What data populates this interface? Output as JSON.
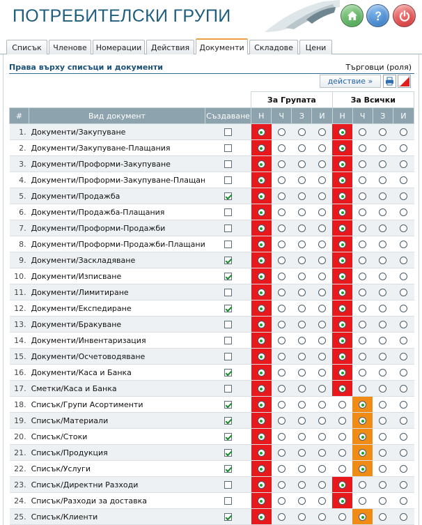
{
  "header": {
    "title": "ПОТРЕБИТЕЛСКИ ГРУПИ",
    "buttons": [
      {
        "name": "home",
        "icon": "home-icon",
        "color": "#4caf50"
      },
      {
        "name": "help",
        "icon": "help-icon",
        "color": "#2f7cc7"
      },
      {
        "name": "power",
        "icon": "power-icon",
        "color": "#d62c2c"
      }
    ]
  },
  "tabs": [
    {
      "label": "Списък",
      "active": false
    },
    {
      "label": "Членове",
      "active": false
    },
    {
      "label": "Номерации",
      "active": false
    },
    {
      "label": "Действия",
      "active": false
    },
    {
      "label": "Документи",
      "active": true
    },
    {
      "label": "Складове",
      "active": false
    },
    {
      "label": "Цени",
      "active": false
    }
  ],
  "section": {
    "title": "Права върху списъци и документи",
    "role": "Търговци (роля)",
    "action_label": "действие »"
  },
  "table": {
    "group_labels": [
      "За Групата",
      "За Всички"
    ],
    "columns": [
      "#",
      "Вид документ",
      "Създаване",
      "Н",
      "Ч",
      "З",
      "И",
      "Н",
      "Ч",
      "З",
      "И"
    ],
    "rows": [
      {
        "num": "1.",
        "doc": "Документи/Закупуване",
        "create": false,
        "group": "Н",
        "all": "Н"
      },
      {
        "num": "2.",
        "doc": "Документи/Закупуване-Плащания",
        "create": false,
        "group": "Н",
        "all": "Н"
      },
      {
        "num": "3.",
        "doc": "Документи/Проформи-Закупуване",
        "create": false,
        "group": "Н",
        "all": "Н"
      },
      {
        "num": "4.",
        "doc": "Документи/Проформи-Закупуване-Плащания",
        "create": false,
        "group": "Н",
        "all": "Н"
      },
      {
        "num": "5.",
        "doc": "Документи/Продажба",
        "create": true,
        "group": "Н",
        "all": "Н"
      },
      {
        "num": "6.",
        "doc": "Документи/Продажба-Плащания",
        "create": false,
        "group": "Н",
        "all": "Н"
      },
      {
        "num": "7.",
        "doc": "Документи/Проформи-Продажби",
        "create": false,
        "group": "Н",
        "all": "Н"
      },
      {
        "num": "8.",
        "doc": "Документи/Проформи-Продажби-Плащания",
        "create": false,
        "group": "Н",
        "all": "Н"
      },
      {
        "num": "9.",
        "doc": "Документи/Заскладяване",
        "create": true,
        "group": "Н",
        "all": "Н"
      },
      {
        "num": "10.",
        "doc": "Документи/Изписване",
        "create": true,
        "group": "Н",
        "all": "Н"
      },
      {
        "num": "11.",
        "doc": "Документи/Лимитиране",
        "create": false,
        "group": "Н",
        "all": "Н"
      },
      {
        "num": "12.",
        "doc": "Документи/Експедиране",
        "create": true,
        "group": "Н",
        "all": "Н"
      },
      {
        "num": "13.",
        "doc": "Документи/Бракуване",
        "create": false,
        "group": "Н",
        "all": "Н"
      },
      {
        "num": "14.",
        "doc": "Документи/Инвентаризация",
        "create": false,
        "group": "Н",
        "all": "Н"
      },
      {
        "num": "15.",
        "doc": "Документи/Осчетоводяване",
        "create": false,
        "group": "Н",
        "all": "Н"
      },
      {
        "num": "16.",
        "doc": "Документи/Каса и Банка",
        "create": true,
        "group": "Н",
        "all": "Н"
      },
      {
        "num": "17.",
        "doc": "Сметки/Каса и Банка",
        "create": false,
        "group": "Н",
        "all": "Н"
      },
      {
        "num": "18.",
        "doc": "Списък/Групи Асортименти",
        "create": true,
        "group": "Н",
        "all": "Ч"
      },
      {
        "num": "19.",
        "doc": "Списък/Материали",
        "create": true,
        "group": "Н",
        "all": "Ч"
      },
      {
        "num": "20.",
        "doc": "Списък/Стоки",
        "create": true,
        "group": "Н",
        "all": "Ч"
      },
      {
        "num": "21.",
        "doc": "Списък/Продукция",
        "create": true,
        "group": "Н",
        "all": "Ч"
      },
      {
        "num": "22.",
        "doc": "Списък/Услуги",
        "create": true,
        "group": "Н",
        "all": "Ч"
      },
      {
        "num": "23.",
        "doc": "Списък/Директни Разходи",
        "create": false,
        "group": "Н",
        "all": "Н"
      },
      {
        "num": "24.",
        "doc": "Списък/Разходи за доставка",
        "create": false,
        "group": "Н",
        "all": "Н"
      },
      {
        "num": "25.",
        "doc": "Списък/Клиенти",
        "create": true,
        "group": "Н",
        "all": "Ч"
      }
    ]
  },
  "colors": {
    "selected_primary": "#e8191d",
    "selected_secondary": "#f08b16",
    "header_bg": "#8da3ad",
    "title": "#1f5e7e"
  }
}
